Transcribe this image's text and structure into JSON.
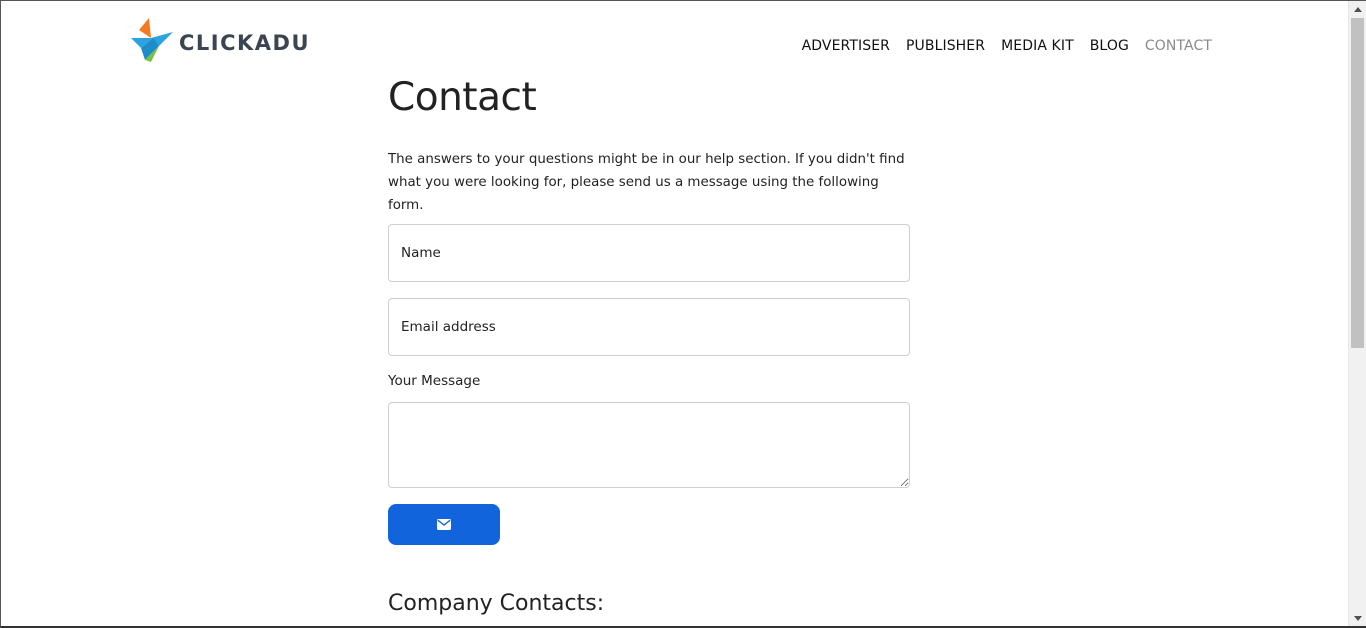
{
  "brand": {
    "name": "CLICKADU",
    "colors": {
      "orange": "#f47a20",
      "blue": "#2aa3e0",
      "green": "#7cc242",
      "text": "#3b4450"
    }
  },
  "nav": {
    "items": [
      {
        "label": "ADVERTISER",
        "active": false
      },
      {
        "label": "PUBLISHER",
        "active": false
      },
      {
        "label": "MEDIA KIT",
        "active": false
      },
      {
        "label": "BLOG",
        "active": false
      },
      {
        "label": "CONTACT",
        "active": true
      }
    ]
  },
  "main": {
    "title": "Contact",
    "intro": "The answers to your questions might be in our help section. If you didn't find what you were looking for, please send us a message using the following form.",
    "form": {
      "name_placeholder": "Name",
      "email_placeholder": "Email address",
      "message_label": "Your Message",
      "message_value": "",
      "submit_icon": "envelope-icon",
      "accent_color": "#1164dc"
    },
    "company_heading": "Company Contacts:"
  }
}
